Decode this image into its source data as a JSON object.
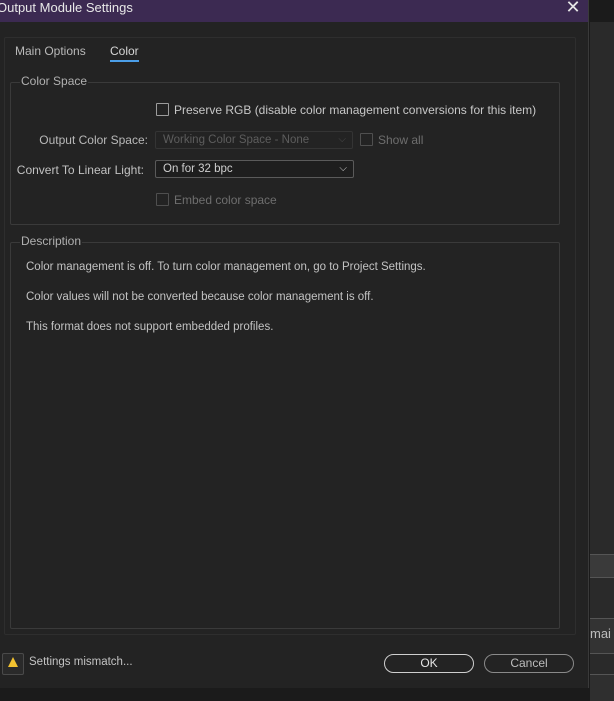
{
  "window": {
    "title": "Output Module Settings",
    "close_glyph": "✕"
  },
  "tabs": [
    {
      "label": "Main Options",
      "active": false
    },
    {
      "label": "Color",
      "active": true
    }
  ],
  "color_space": {
    "legend": "Color Space",
    "preserve_rgb_label": "Preserve RGB (disable color management conversions for this item)",
    "output_color_space_label": "Output Color Space:",
    "output_color_space_value": "Working Color Space - None",
    "show_all_label": "Show all",
    "convert_linear_label": "Convert To Linear Light:",
    "convert_linear_value": "On for 32 bpc",
    "embed_label": "Embed color space"
  },
  "description": {
    "legend": "Description",
    "lines": [
      "Color management is off. To turn color management on, go to Project Settings.",
      "Color values will not be converted because color management is off.",
      "This format does not support embedded profiles."
    ]
  },
  "footer": {
    "warning_text": "Settings mismatch...",
    "ok_label": "OK",
    "cancel_label": "Cancel"
  },
  "backdrop": {
    "partial_text": "mai"
  },
  "colors": {
    "titlebar": "#3c2a52",
    "accent": "#4b9ee8",
    "warning": "#f2c230"
  }
}
